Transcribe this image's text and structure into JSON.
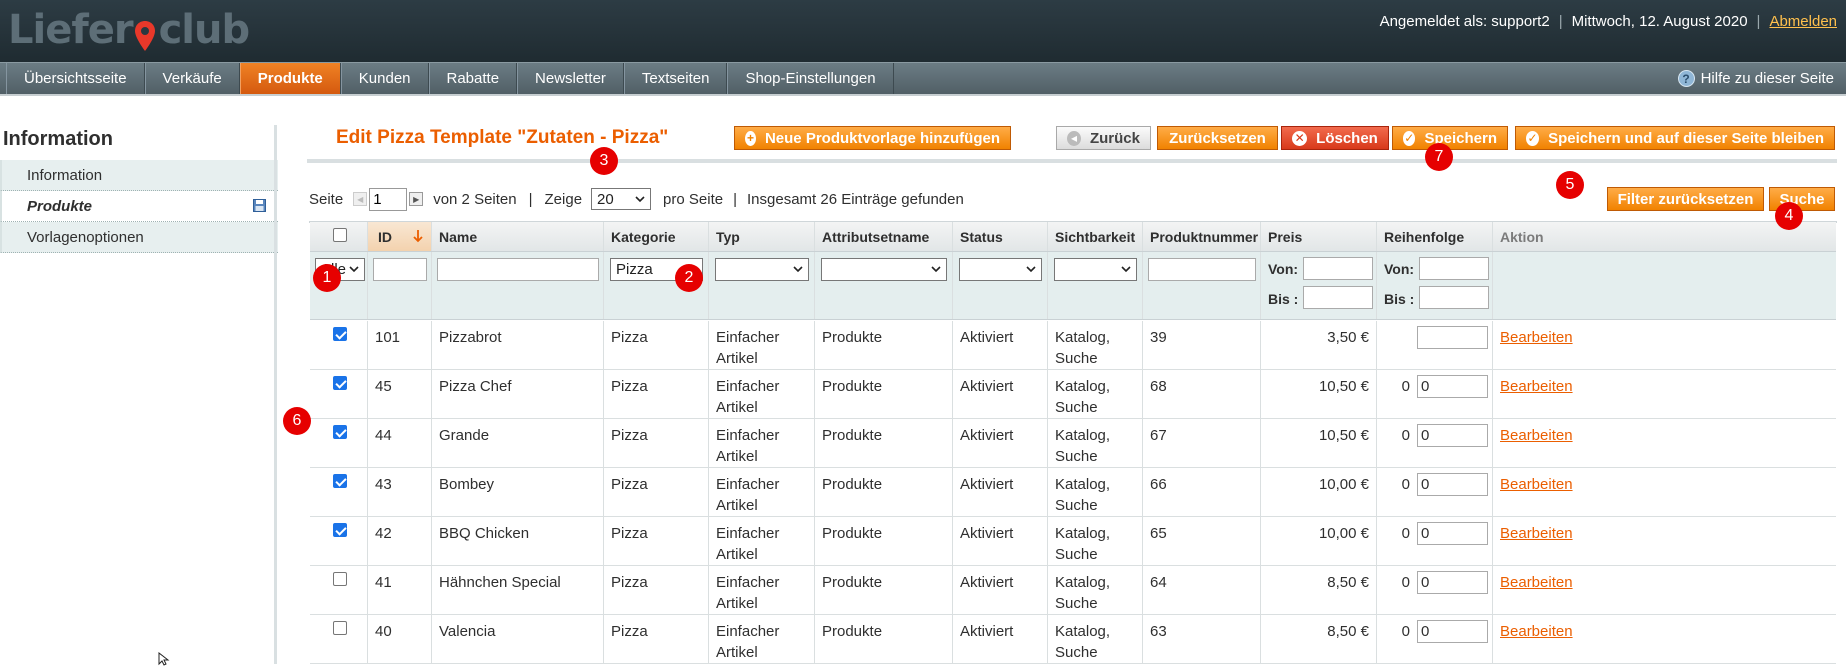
{
  "header": {
    "logo_pre": "Liefer",
    "logo_post": "club",
    "logged_in": "Angemeldet als: support2",
    "date": "Mittwoch, 12. August 2020",
    "logout": "Abmelden"
  },
  "nav": {
    "tabs": [
      "Übersichtsseite",
      "Verkäufe",
      "Produkte",
      "Kunden",
      "Rabatte",
      "Newsletter",
      "Textseiten",
      "Shop-Einstellungen"
    ],
    "active_index": 2,
    "help": "Hilfe zu dieser Seite"
  },
  "sidebar": {
    "title": "Information",
    "items": [
      {
        "label": "Information",
        "active": false
      },
      {
        "label": "Produkte",
        "active": true
      },
      {
        "label": "Vorlagenoptionen",
        "active": false
      }
    ]
  },
  "page": {
    "title": "Edit Pizza Template \"Zutaten - Pizza\"",
    "buttons": {
      "new_template": "Neue Produktvorlage hinzufügen",
      "back": "Zurück",
      "reset": "Zurücksetzen",
      "delete": "Löschen",
      "save": "Speichern",
      "save_continue": "Speichern und auf dieser Seite bleiben",
      "reset_filter": "Filter zurücksetzen",
      "search": "Suche"
    }
  },
  "pager": {
    "page_label": "Seite",
    "page_value": "1",
    "of_pages": "von 2 Seiten",
    "sep": "|",
    "show_label": "Zeige",
    "per_page": "20",
    "per_page_label": "pro Seite",
    "total": "Insgesamt 26 Einträge gefunden"
  },
  "grid": {
    "columns": [
      "",
      "ID",
      "Name",
      "Kategorie",
      "Typ",
      "Attributsetname",
      "Status",
      "Sichtbarkeit",
      "Produktnummer",
      "Preis",
      "Reihenfolge",
      "Aktion"
    ],
    "filters": {
      "select_all": "Alle",
      "category": "Pizza",
      "from": "Von:",
      "to": "Bis :"
    },
    "rows": [
      {
        "checked": true,
        "id": "101",
        "name": "Pizzabrot",
        "category": "Pizza",
        "type": "Einfacher Artikel",
        "attrset": "Produkte",
        "status": "Aktiviert",
        "vis1": "Katalog,",
        "vis2": "Suche",
        "sku": "39",
        "price": "3,50 €",
        "order": "",
        "order_input": "",
        "action": "Bearbeiten"
      },
      {
        "checked": true,
        "id": "45",
        "name": "Pizza Chef",
        "category": "Pizza",
        "type": "Einfacher Artikel",
        "attrset": "Produkte",
        "status": "Aktiviert",
        "vis1": "Katalog,",
        "vis2": "Suche",
        "sku": "68",
        "price": "10,50 €",
        "order": "0",
        "order_input": "0",
        "action": "Bearbeiten"
      },
      {
        "checked": true,
        "id": "44",
        "name": "Grande",
        "category": "Pizza",
        "type": "Einfacher Artikel",
        "attrset": "Produkte",
        "status": "Aktiviert",
        "vis1": "Katalog,",
        "vis2": "Suche",
        "sku": "67",
        "price": "10,50 €",
        "order": "0",
        "order_input": "0",
        "action": "Bearbeiten"
      },
      {
        "checked": true,
        "id": "43",
        "name": "Bombey",
        "category": "Pizza",
        "type": "Einfacher Artikel",
        "attrset": "Produkte",
        "status": "Aktiviert",
        "vis1": "Katalog,",
        "vis2": "Suche",
        "sku": "66",
        "price": "10,00 €",
        "order": "0",
        "order_input": "0",
        "action": "Bearbeiten"
      },
      {
        "checked": true,
        "id": "42",
        "name": "BBQ Chicken",
        "category": "Pizza",
        "type": "Einfacher Artikel",
        "attrset": "Produkte",
        "status": "Aktiviert",
        "vis1": "Katalog,",
        "vis2": "Suche",
        "sku": "65",
        "price": "10,00 €",
        "order": "0",
        "order_input": "0",
        "action": "Bearbeiten"
      },
      {
        "checked": false,
        "id": "41",
        "name": "Hähnchen Special",
        "category": "Pizza",
        "type": "Einfacher Artikel",
        "attrset": "Produkte",
        "status": "Aktiviert",
        "vis1": "Katalog,",
        "vis2": "Suche",
        "sku": "64",
        "price": "8,50 €",
        "order": "0",
        "order_input": "0",
        "action": "Bearbeiten"
      },
      {
        "checked": false,
        "id": "40",
        "name": "Valencia",
        "category": "Pizza",
        "type": "Einfacher Artikel",
        "attrset": "Produkte",
        "status": "Aktiviert",
        "vis1": "Katalog,",
        "vis2": "Suche",
        "sku": "63",
        "price": "8,50 €",
        "order": "0",
        "order_input": "0",
        "action": "Bearbeiten"
      }
    ]
  },
  "markers": [
    "1",
    "2",
    "3",
    "4",
    "5",
    "6",
    "7"
  ],
  "colors": {
    "accent": "#eb5e00",
    "button": "#f18200",
    "danger": "#d8391a",
    "marker": "#e60000"
  }
}
